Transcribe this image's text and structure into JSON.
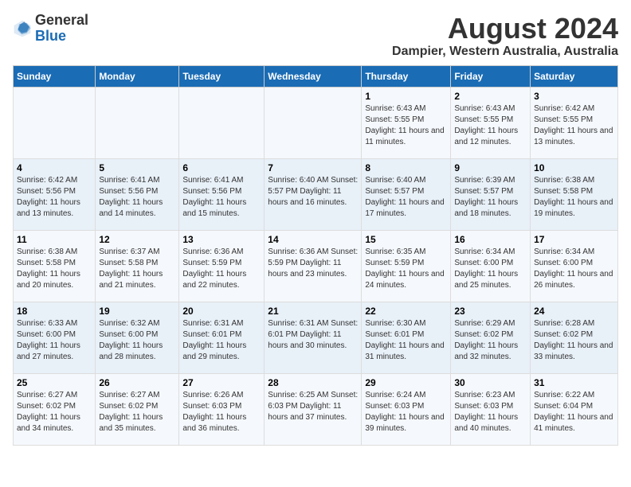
{
  "header": {
    "logo_general": "General",
    "logo_blue": "Blue",
    "main_title": "August 2024",
    "subtitle": "Dampier, Western Australia, Australia"
  },
  "calendar": {
    "days_of_week": [
      "Sunday",
      "Monday",
      "Tuesday",
      "Wednesday",
      "Thursday",
      "Friday",
      "Saturday"
    ],
    "weeks": [
      [
        {
          "day": "",
          "info": ""
        },
        {
          "day": "",
          "info": ""
        },
        {
          "day": "",
          "info": ""
        },
        {
          "day": "",
          "info": ""
        },
        {
          "day": "1",
          "info": "Sunrise: 6:43 AM\nSunset: 5:55 PM\nDaylight: 11 hours\nand 11 minutes."
        },
        {
          "day": "2",
          "info": "Sunrise: 6:43 AM\nSunset: 5:55 PM\nDaylight: 11 hours\nand 12 minutes."
        },
        {
          "day": "3",
          "info": "Sunrise: 6:42 AM\nSunset: 5:55 PM\nDaylight: 11 hours\nand 13 minutes."
        }
      ],
      [
        {
          "day": "4",
          "info": "Sunrise: 6:42 AM\nSunset: 5:56 PM\nDaylight: 11 hours\nand 13 minutes."
        },
        {
          "day": "5",
          "info": "Sunrise: 6:41 AM\nSunset: 5:56 PM\nDaylight: 11 hours\nand 14 minutes."
        },
        {
          "day": "6",
          "info": "Sunrise: 6:41 AM\nSunset: 5:56 PM\nDaylight: 11 hours\nand 15 minutes."
        },
        {
          "day": "7",
          "info": "Sunrise: 6:40 AM\nSunset: 5:57 PM\nDaylight: 11 hours\nand 16 minutes."
        },
        {
          "day": "8",
          "info": "Sunrise: 6:40 AM\nSunset: 5:57 PM\nDaylight: 11 hours\nand 17 minutes."
        },
        {
          "day": "9",
          "info": "Sunrise: 6:39 AM\nSunset: 5:57 PM\nDaylight: 11 hours\nand 18 minutes."
        },
        {
          "day": "10",
          "info": "Sunrise: 6:38 AM\nSunset: 5:58 PM\nDaylight: 11 hours\nand 19 minutes."
        }
      ],
      [
        {
          "day": "11",
          "info": "Sunrise: 6:38 AM\nSunset: 5:58 PM\nDaylight: 11 hours\nand 20 minutes."
        },
        {
          "day": "12",
          "info": "Sunrise: 6:37 AM\nSunset: 5:58 PM\nDaylight: 11 hours\nand 21 minutes."
        },
        {
          "day": "13",
          "info": "Sunrise: 6:36 AM\nSunset: 5:59 PM\nDaylight: 11 hours\nand 22 minutes."
        },
        {
          "day": "14",
          "info": "Sunrise: 6:36 AM\nSunset: 5:59 PM\nDaylight: 11 hours\nand 23 minutes."
        },
        {
          "day": "15",
          "info": "Sunrise: 6:35 AM\nSunset: 5:59 PM\nDaylight: 11 hours\nand 24 minutes."
        },
        {
          "day": "16",
          "info": "Sunrise: 6:34 AM\nSunset: 6:00 PM\nDaylight: 11 hours\nand 25 minutes."
        },
        {
          "day": "17",
          "info": "Sunrise: 6:34 AM\nSunset: 6:00 PM\nDaylight: 11 hours\nand 26 minutes."
        }
      ],
      [
        {
          "day": "18",
          "info": "Sunrise: 6:33 AM\nSunset: 6:00 PM\nDaylight: 11 hours\nand 27 minutes."
        },
        {
          "day": "19",
          "info": "Sunrise: 6:32 AM\nSunset: 6:00 PM\nDaylight: 11 hours\nand 28 minutes."
        },
        {
          "day": "20",
          "info": "Sunrise: 6:31 AM\nSunset: 6:01 PM\nDaylight: 11 hours\nand 29 minutes."
        },
        {
          "day": "21",
          "info": "Sunrise: 6:31 AM\nSunset: 6:01 PM\nDaylight: 11 hours\nand 30 minutes."
        },
        {
          "day": "22",
          "info": "Sunrise: 6:30 AM\nSunset: 6:01 PM\nDaylight: 11 hours\nand 31 minutes."
        },
        {
          "day": "23",
          "info": "Sunrise: 6:29 AM\nSunset: 6:02 PM\nDaylight: 11 hours\nand 32 minutes."
        },
        {
          "day": "24",
          "info": "Sunrise: 6:28 AM\nSunset: 6:02 PM\nDaylight: 11 hours\nand 33 minutes."
        }
      ],
      [
        {
          "day": "25",
          "info": "Sunrise: 6:27 AM\nSunset: 6:02 PM\nDaylight: 11 hours\nand 34 minutes."
        },
        {
          "day": "26",
          "info": "Sunrise: 6:27 AM\nSunset: 6:02 PM\nDaylight: 11 hours\nand 35 minutes."
        },
        {
          "day": "27",
          "info": "Sunrise: 6:26 AM\nSunset: 6:03 PM\nDaylight: 11 hours\nand 36 minutes."
        },
        {
          "day": "28",
          "info": "Sunrise: 6:25 AM\nSunset: 6:03 PM\nDaylight: 11 hours\nand 37 minutes."
        },
        {
          "day": "29",
          "info": "Sunrise: 6:24 AM\nSunset: 6:03 PM\nDaylight: 11 hours\nand 39 minutes."
        },
        {
          "day": "30",
          "info": "Sunrise: 6:23 AM\nSunset: 6:03 PM\nDaylight: 11 hours\nand 40 minutes."
        },
        {
          "day": "31",
          "info": "Sunrise: 6:22 AM\nSunset: 6:04 PM\nDaylight: 11 hours\nand 41 minutes."
        }
      ]
    ]
  }
}
